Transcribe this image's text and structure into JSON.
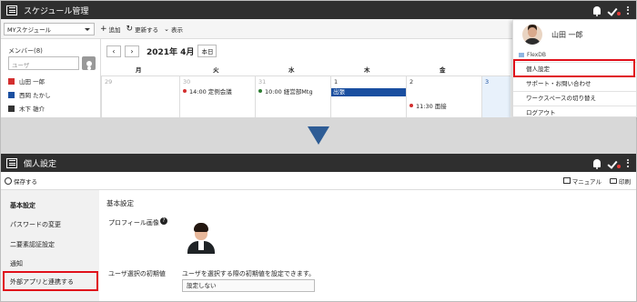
{
  "top": {
    "title": "スケジュール管理",
    "toolbar": {
      "view_select": "MYスケジュール",
      "add": "追加",
      "refresh": "更新する",
      "display": "表示"
    },
    "members": {
      "header": "メンバー(8)",
      "search_placeholder": "ユーザ",
      "list": [
        {
          "name": "山田 一郎",
          "color": "#d32f2f"
        },
        {
          "name": "西岡 たかし",
          "color": "#1a4fa0"
        },
        {
          "name": "木下 雄介",
          "color": "#333333"
        }
      ]
    },
    "calendar": {
      "month": "2021年 4月",
      "today": "本日",
      "weekdays": [
        "月",
        "火",
        "水",
        "木",
        "金"
      ],
      "days": [
        "29",
        "30",
        "31",
        "1",
        "2",
        "3"
      ],
      "events": [
        {
          "label": "14:00 定例会議",
          "color": "#d32f2f"
        },
        {
          "label": "10:00 経営部Mtg",
          "color": "#2e7d32"
        },
        {
          "label": "出張",
          "color": "#1a4fa0"
        },
        {
          "label": "11:30 面接",
          "color": "#d32f2f"
        }
      ]
    },
    "dropdown": {
      "user": "山田 一郎",
      "flexdb": "FlexDB",
      "items": [
        "個人設定",
        "サポート・お問い合わせ",
        "ワークスペースの切り替え",
        "ログアウト"
      ]
    }
  },
  "bottom": {
    "title": "個人設定",
    "save": "保存する",
    "manual": "マニュアル",
    "print": "印刷",
    "side_items": [
      "基本設定",
      "パスワードの変更",
      "二要素認証設定",
      "通知",
      "外部アプリと連携する"
    ],
    "main": {
      "heading": "基本設定",
      "profile_label": "プロフィール画像",
      "order_label": "ユーザ選択の初期値",
      "order_desc": "ユーザを選択する際の初期値を設定できます。",
      "order_value": "設定しない"
    }
  },
  "colors": {
    "titlebar": "#2f2f2f",
    "highlight": "#e0101a",
    "arrow": "#2e5c95"
  }
}
